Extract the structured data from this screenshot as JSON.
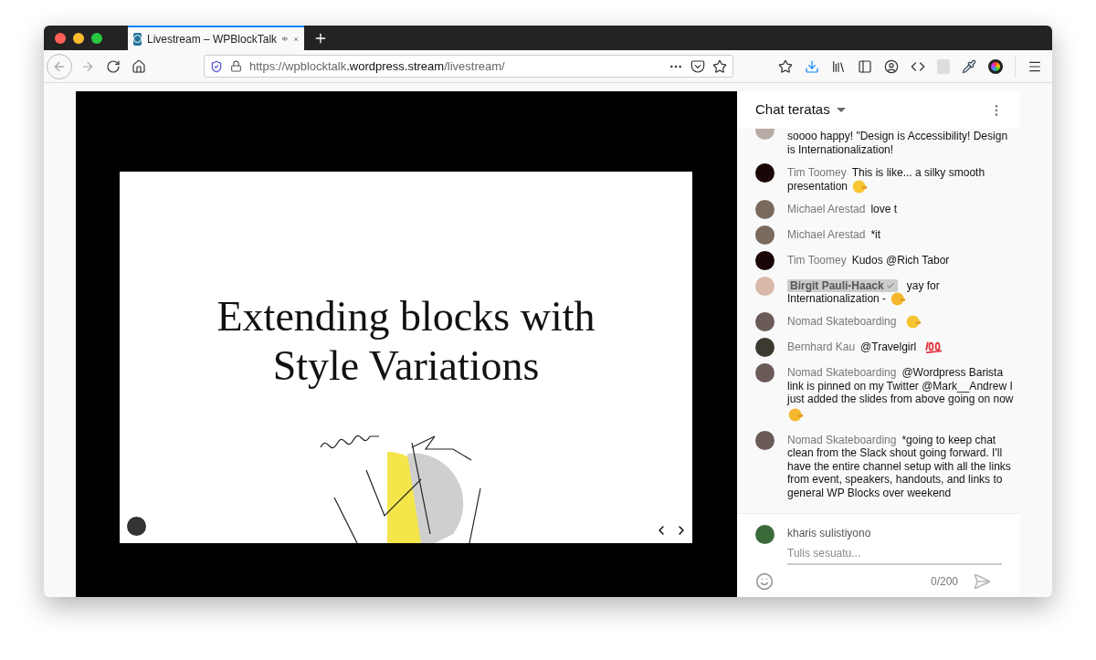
{
  "tab": {
    "title": "Livestream – WPBlockTalk",
    "selected": true
  },
  "address_bar": {
    "scheme": "https://",
    "host_start": "wpblocktalk",
    "host_end": ".wordpress.stream",
    "path": "/livestream/"
  },
  "slide": {
    "title_lines": [
      "Extending blocks with",
      "Style Variations"
    ]
  },
  "chat": {
    "title": "Chat teratas",
    "messages": [
      {
        "kind": "continued",
        "lines": [
          "soooo happy! \"Design is Accessibility! Design",
          "is Internationalization!"
        ],
        "color": "#b9aaa4"
      },
      {
        "kind": "message",
        "author": "Tim Toomey",
        "lines": [
          "This is like... a silky smooth",
          "presentation"
        ],
        "color": "#1a0606",
        "emoji": {
          "kind": "hug"
        },
        "highlighted": false
      },
      {
        "kind": "message",
        "author": "Michael Arestad",
        "lines": [
          "love t"
        ],
        "color": "#7a6a5e",
        "highlighted": false
      },
      {
        "kind": "message",
        "author": "Michael Arestad",
        "lines": [
          "*it"
        ],
        "color": "#7a6a5e",
        "highlighted": false
      },
      {
        "kind": "message",
        "author": "Tim Toomey",
        "lines": [
          "Kudos @Rich Tabor"
        ],
        "color": "#1a0606",
        "highlighted": false
      },
      {
        "kind": "message",
        "author": "Birgit Pauli-Haack",
        "lines": [
          "yay for",
          "Internationalization -"
        ],
        "color": "#d8b8a8",
        "emoji": {
          "kind": "thumbs"
        },
        "highlighted": true
      },
      {
        "kind": "message",
        "author": "Nomad Skateboarding",
        "color": "#6a5a58",
        "emoji": {
          "kind": "point"
        },
        "highlighted": false
      },
      {
        "kind": "message",
        "author": "Bernhard Kau",
        "lines": [
          "@Travelgirl"
        ],
        "color": "#3c3a30",
        "emoji": {
          "kind": "hundred"
        },
        "highlighted": false
      },
      {
        "kind": "message",
        "author": "Nomad Skateboarding",
        "lines": [
          "@Wordpress Barista",
          "link is pinned on my Twitter @Mark__Andrew I",
          "just added the slides from above going on now"
        ],
        "color": "#6a5a58",
        "emoji": {
          "kind": "hands"
        },
        "highlighted": false
      },
      {
        "kind": "message",
        "author": "Nomad Skateboarding",
        "lines": [
          "*going to keep chat",
          "clean from the Slack shout going forward. I'll",
          "have the entire channel setup with all the links",
          "from event, speakers, handouts, and links to",
          "general WP Blocks over weekend"
        ],
        "color": "#6a5a58",
        "highlighted": false
      }
    ],
    "composer": {
      "user": "kharis sulistiyono",
      "placeholder": "Tulis sesuatu...",
      "counter": "0/200"
    }
  }
}
